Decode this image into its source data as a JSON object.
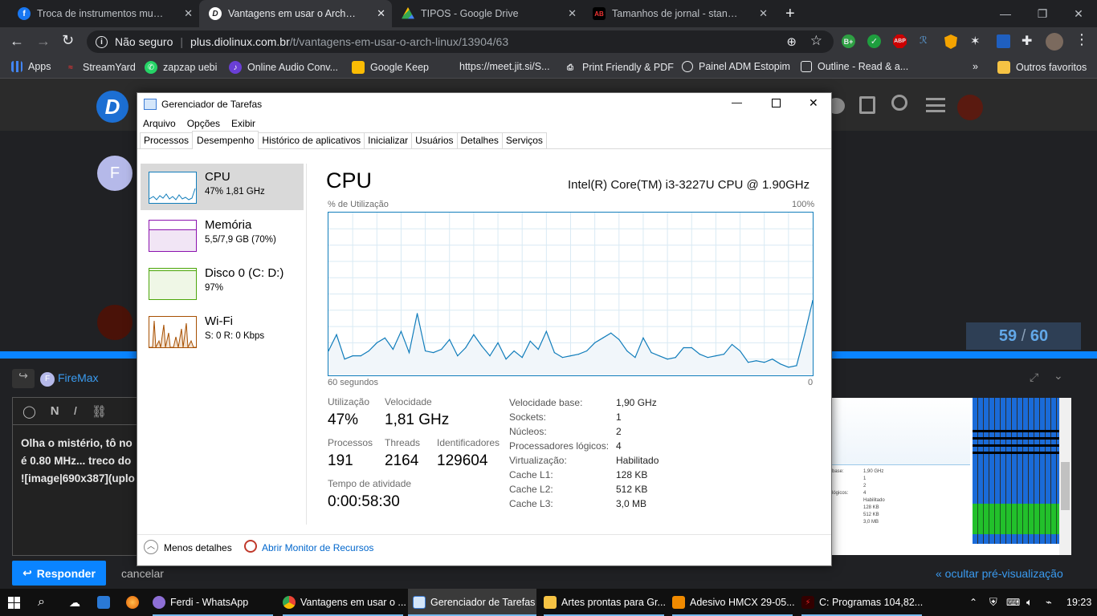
{
  "browser": {
    "tabs": [
      {
        "title": "Troca de instrumentos musicais R",
        "icon": "facebook-icon",
        "active": false
      },
      {
        "title": "Vantagens em usar o Arch Linux",
        "icon": "diolinux-icon",
        "active": true
      },
      {
        "title": "TIPOS - Google Drive",
        "icon": "google-drive-icon",
        "active": false
      },
      {
        "title": "Tamanhos de jornal - standard, b",
        "icon": "abc-icon",
        "active": false
      }
    ],
    "security": "Não seguro",
    "url_host": "plus.diolinux.com.br",
    "url_path": "/t/vantagens-em-usar-o-arch-linux/13904/63",
    "bookmarks": [
      "Apps",
      "StreamYard",
      "zapzap uebi",
      "Online Audio Conv...",
      "Google Keep",
      "https://meet.jit.si/S...",
      "Print Friendly & PDF",
      "Painel ADM Estopim",
      "Outline - Read & a..."
    ],
    "bookmarks_more": "»",
    "other_bookmarks": "Outros favoritos"
  },
  "page": {
    "avatar_letter": "F",
    "progress": "59",
    "progress_sep": "/",
    "progress_total": "60",
    "reply_user": "FireMax",
    "editor_text_1": "Olha o mistério, tô no",
    "editor_text_2": "é 0.80 MHz... treco do",
    "editor_text_3": "![image|690x387](uplo",
    "reply_button": "Responder",
    "cancel": "cancelar",
    "hide_preview": "« ocultar pré-visualização",
    "preview_values": [
      "1,90 GHz",
      "1",
      "2",
      "4",
      "Habilitado",
      "128 KB",
      "512 KB",
      "3,0 MB"
    ],
    "preview_labels": [
      "base:",
      "",
      "",
      "lógicos:",
      "",
      ""
    ]
  },
  "taskmanager": {
    "title": "Gerenciador de Tarefas",
    "menu": [
      "Arquivo",
      "Opções",
      "Exibir"
    ],
    "tabs": [
      "Processos",
      "Desempenho",
      "Histórico de aplicativos",
      "Inicializar",
      "Usuários",
      "Detalhes",
      "Serviços"
    ],
    "active_tab": "Desempenho",
    "side": [
      {
        "name": "CPU",
        "sub": "47% 1,81 GHz"
      },
      {
        "name": "Memória",
        "sub": "5,5/7,9 GB (70%)"
      },
      {
        "name": "Disco 0 (C: D:)",
        "sub": "97%"
      },
      {
        "name": "Wi-Fi",
        "sub_prefix": "S: 0 R: ",
        "sub_value": "0 Kbps"
      }
    ],
    "heading": "CPU",
    "cpu_model": "Intel(R) Core(TM) i3-3227U CPU @ 1.90GHz",
    "util_label": "% de Utilização",
    "util_max": "100%",
    "time_label": "60 segundos",
    "time_min": "0",
    "stats": {
      "utilizacao_label": "Utilização",
      "utilizacao": "47%",
      "velocidade_label": "Velocidade",
      "velocidade": "1,81 GHz",
      "processos_label": "Processos",
      "processos": "191",
      "threads_label": "Threads",
      "threads": "2164",
      "ident_label": "Identificadores",
      "ident": "129604",
      "uptime_label": "Tempo de atividade",
      "uptime": "0:00:58:30"
    },
    "details": [
      {
        "k": "Velocidade base:",
        "v": "1,90 GHz"
      },
      {
        "k": "Sockets:",
        "v": "1"
      },
      {
        "k": "Núcleos:",
        "v": "2"
      },
      {
        "k": "Processadores lógicos:",
        "v": "4"
      },
      {
        "k": "Virtualização:",
        "v": "Habilitado"
      },
      {
        "k": "Cache L1:",
        "v": "128 KB"
      },
      {
        "k": "Cache L2:",
        "v": "512 KB"
      },
      {
        "k": "Cache L3:",
        "v": "3,0 MB"
      }
    ],
    "less_details": "Menos detalhes",
    "resource_monitor": "Abrir Monitor de Recursos",
    "colors": {
      "cpu_line": "#117dbb",
      "mem": "#8b12ae",
      "disk": "#4da60c",
      "wifi": "#a74f01"
    }
  },
  "chart_data": {
    "type": "area",
    "title": "CPU",
    "ylabel": "% de Utilização",
    "xlabel": "60 segundos",
    "ylim": [
      0,
      100
    ],
    "x": [
      60,
      59,
      58,
      57,
      56,
      55,
      54,
      53,
      52,
      51,
      50,
      49,
      48,
      47,
      46,
      45,
      44,
      43,
      42,
      41,
      40,
      39,
      38,
      37,
      36,
      35,
      34,
      33,
      32,
      31,
      30,
      29,
      28,
      27,
      26,
      25,
      24,
      23,
      22,
      21,
      20,
      19,
      18,
      17,
      16,
      15,
      14,
      13,
      12,
      11,
      10,
      9,
      8,
      7,
      6,
      5,
      4,
      3,
      2,
      1,
      0
    ],
    "values": [
      15,
      25,
      10,
      12,
      12,
      15,
      20,
      23,
      16,
      27,
      14,
      38,
      15,
      14,
      16,
      22,
      12,
      17,
      25,
      18,
      12,
      20,
      10,
      15,
      11,
      21,
      16,
      27,
      14,
      11,
      12,
      13,
      15,
      20,
      23,
      26,
      22,
      15,
      11,
      23,
      14,
      12,
      10,
      11,
      17,
      17,
      13,
      11,
      12,
      13,
      19,
      15,
      8,
      9,
      8,
      10,
      7,
      5,
      6,
      25,
      46
    ]
  },
  "taskbar": {
    "items": [
      {
        "label": "Ferdi - WhatsApp",
        "icon": "whatsapp-icon"
      },
      {
        "label": "Vantagens em usar o ...",
        "icon": "chrome-icon"
      },
      {
        "label": "Gerenciador de Tarefas",
        "icon": "taskmanager-icon"
      },
      {
        "label": "Artes prontas para Gr...",
        "icon": "folder-icon"
      },
      {
        "label": "Adesivo HMCX 29-05...",
        "icon": "coreldraw-icon"
      },
      {
        "label": "C: Programas  104,82...",
        "icon": "app-icon"
      }
    ],
    "clock": "19:23"
  }
}
